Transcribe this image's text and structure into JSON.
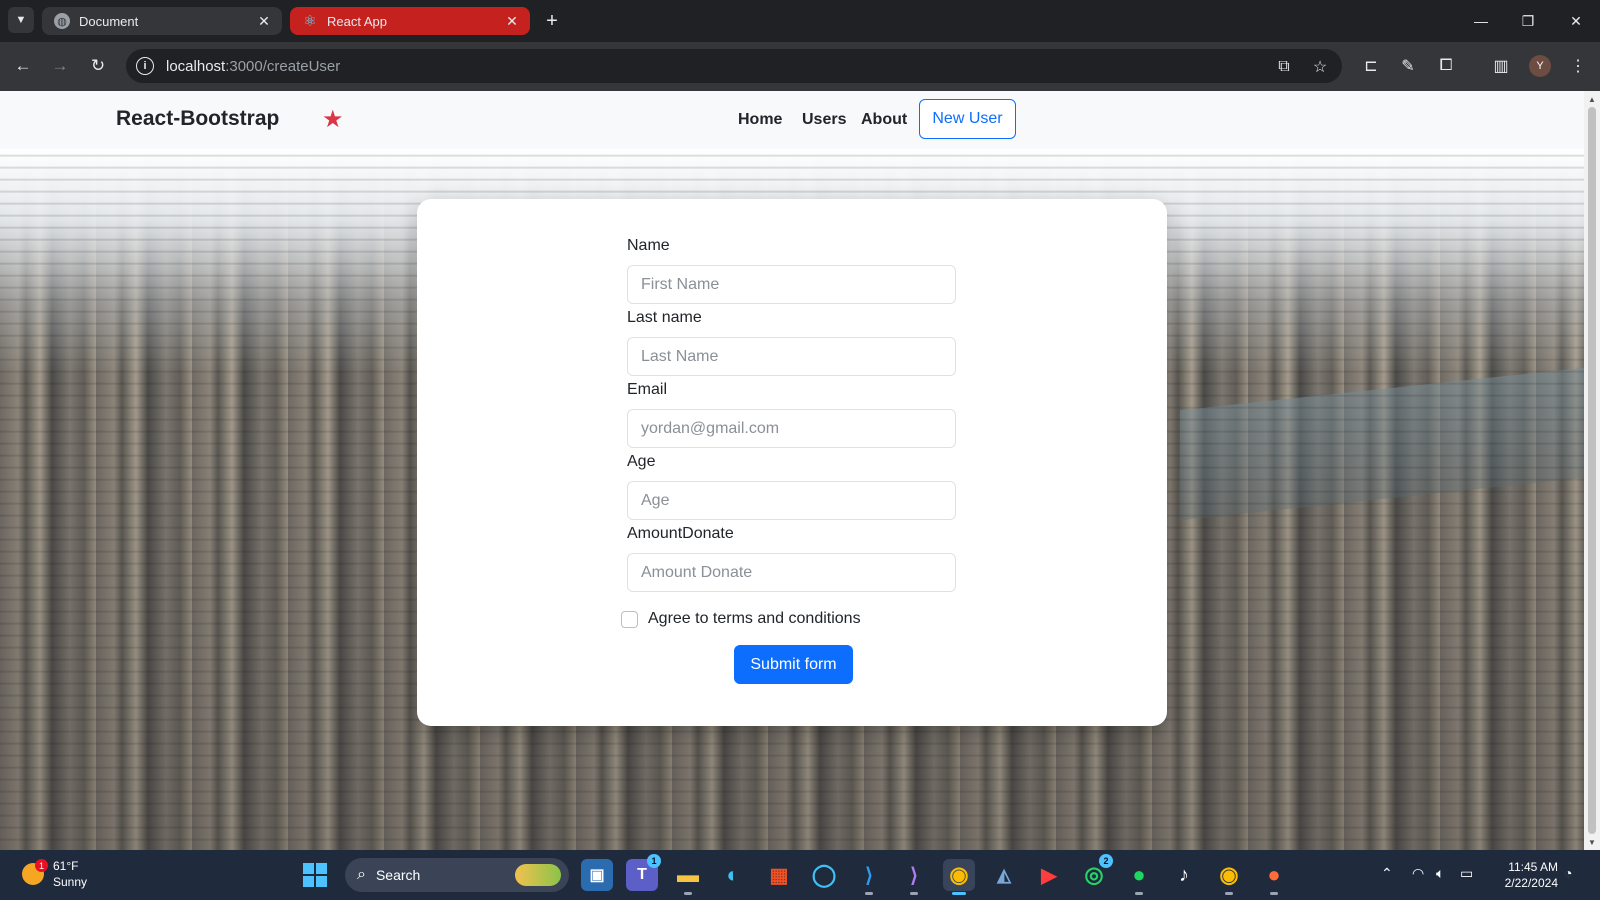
{
  "browser": {
    "tabs": [
      {
        "title": "Document",
        "active": false
      },
      {
        "title": "React App",
        "active": true
      }
    ],
    "url_host": "localhost",
    "url_path": ":3000/createUser",
    "profile_initial": "Y"
  },
  "navbar": {
    "brand": "React-Bootstrap",
    "links": [
      "Home",
      "Users",
      "About"
    ],
    "cta": "New User",
    "accent_color": "#0d6efd",
    "star_color": "#dc3545"
  },
  "form": {
    "fields": [
      {
        "label": "Name",
        "placeholder": "First Name"
      },
      {
        "label": "Last name",
        "placeholder": "Last Name"
      },
      {
        "label": "Email",
        "placeholder": "yordan@gmail.com"
      },
      {
        "label": "Age",
        "placeholder": "Age"
      },
      {
        "label": "AmountDonate",
        "placeholder": "Amount Donate"
      }
    ],
    "checkbox_label": "Agree to terms and conditions",
    "submit_label": "Submit form"
  },
  "taskbar": {
    "weather_temp": "61°F",
    "weather_desc": "Sunny",
    "weather_badge": "1",
    "search_label": "Search",
    "teams_badge": "1",
    "whatsapp_badge": "2",
    "time": "11:45 AM",
    "date": "2/22/2024"
  }
}
